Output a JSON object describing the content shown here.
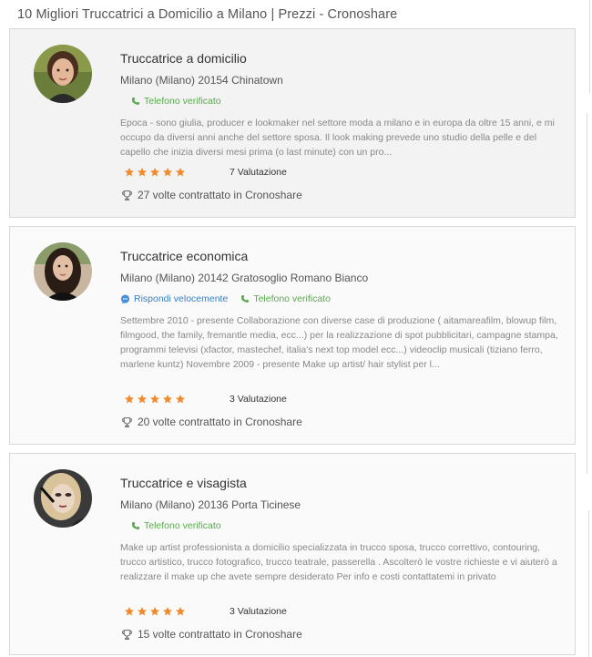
{
  "page_title": "10 Migliori Truccatrici a Domicilio a Milano | Prezzi - Cronoshare",
  "colors": {
    "verified_green": "#5aa94f",
    "fast_reply_blue": "#3a7fc1",
    "star_orange": "#f08a2c"
  },
  "icons": {
    "verified": "phone-icon",
    "fast_reply": "chat-bubble-icon",
    "rating": "star-icon",
    "hired": "trophy-icon"
  },
  "cards": [
    {
      "title": "Truccatrice a domicilio",
      "location": "Milano (Milano) 20154 Chinatown",
      "badges": {
        "fast_reply": null,
        "phone": "Telefono verificato"
      },
      "description": "Epoca - sono giulia, producer e lookmaker nel settore moda a milano e in europa da oltre 15 anni, e mi occupo da diversi anni anche del settore sposa. Il look making prevede uno studio della pelle e del capello che inizia diversi mesi prima (o last minute) con un pro...",
      "stars": 5,
      "rating_label": "7 Valutazione",
      "hired_label": "27 volte contrattato in Cronoshare"
    },
    {
      "title": "Truccatrice economica",
      "location": "Milano (Milano) 20142 Gratosoglio Romano Bianco",
      "badges": {
        "fast_reply": "Rispondi velocemente",
        "phone": "Telefono verificato"
      },
      "description": "Settembre 2010 - presente Collaborazione con diverse case di produzione ( aitamareafilm, blowup film, filmgood, the family, fremantle media, ecc...) per la realizzazione di spot pubblicitari, campagne stampa, programmi televisi (xfactor, mastechef, italia's next top model ecc...) videoclip musicali (tiziano ferro, marlene kuntz) Novembre 2009 - presente Make up artist/ hair stylist per l...",
      "stars": 5,
      "rating_label": "3 Valutazione",
      "hired_label": "20 volte contrattato in Cronoshare"
    },
    {
      "title": "Truccatrice e visagista",
      "location": "Milano (Milano) 20136 Porta Ticinese",
      "badges": {
        "fast_reply": null,
        "phone": "Telefono verificato"
      },
      "description": "Make up artist professionista a domicilio specializzata in trucco sposa, trucco correttivo, contouring, trucco artistico, trucco fotografico, trucco teatrale, passerella . Ascolterò le vostre richieste e vi aiuterò a realizzare il make up che avete sempre desiderato Per info e costi contattatemi in privato",
      "stars": 5,
      "rating_label": "3 Valutazione",
      "hired_label": "15 volte contrattato in Cronoshare"
    }
  ]
}
